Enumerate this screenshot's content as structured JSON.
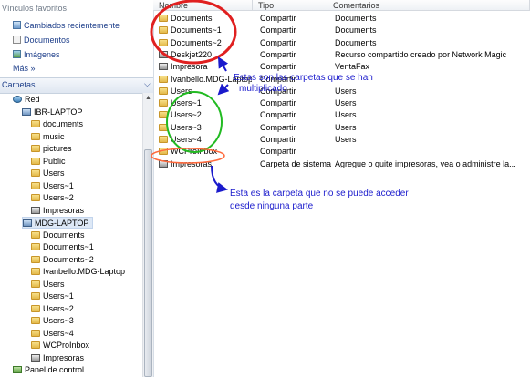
{
  "favorites": {
    "header": "Vínculos favoritos",
    "items": [
      {
        "label": "Cambiados recientemente",
        "icon": "recent-places-icon"
      },
      {
        "label": "Documentos",
        "icon": "documents-icon"
      },
      {
        "label": "Imágenes",
        "icon": "pictures-icon"
      }
    ],
    "more": "Más »"
  },
  "tree": {
    "header": "Carpetas",
    "items": [
      {
        "label": "Red",
        "icon": "network-icon"
      },
      {
        "label": "IBR-LAPTOP",
        "icon": "computer-icon"
      },
      {
        "label": "documents",
        "icon": "folder-icon"
      },
      {
        "label": "music",
        "icon": "folder-icon"
      },
      {
        "label": "pictures",
        "icon": "folder-icon"
      },
      {
        "label": "Public",
        "icon": "folder-icon"
      },
      {
        "label": "Users",
        "icon": "folder-icon"
      },
      {
        "label": "Users~1",
        "icon": "folder-icon"
      },
      {
        "label": "Users~2",
        "icon": "folder-icon"
      },
      {
        "label": "Impresoras",
        "icon": "printer-icon"
      },
      {
        "label": "MDG-LAPTOP",
        "icon": "computer-icon"
      },
      {
        "label": "Documents",
        "icon": "folder-icon"
      },
      {
        "label": "Documents~1",
        "icon": "folder-icon"
      },
      {
        "label": "Documents~2",
        "icon": "folder-icon"
      },
      {
        "label": "Ivanbello.MDG-Laptop",
        "icon": "folder-icon"
      },
      {
        "label": "Users",
        "icon": "folder-icon"
      },
      {
        "label": "Users~1",
        "icon": "folder-icon"
      },
      {
        "label": "Users~2",
        "icon": "folder-icon"
      },
      {
        "label": "Users~3",
        "icon": "folder-icon"
      },
      {
        "label": "Users~4",
        "icon": "folder-icon"
      },
      {
        "label": "WCProInbox",
        "icon": "folder-icon"
      },
      {
        "label": "Impresoras",
        "icon": "printer-icon"
      },
      {
        "label": "Panel de control",
        "icon": "control-panel-icon"
      }
    ]
  },
  "table": {
    "columns": [
      "Nombre",
      "Tipo",
      "Comentarios"
    ],
    "rows": [
      {
        "name": "Documents",
        "type": "Compartir",
        "comment": "Documents",
        "icon": "folder-icon"
      },
      {
        "name": "Documents~1",
        "type": "Compartir",
        "comment": "Documents",
        "icon": "folder-icon"
      },
      {
        "name": "Documents~2",
        "type": "Compartir",
        "comment": "Documents",
        "icon": "folder-icon"
      },
      {
        "name": "Deskjet220",
        "type": "Compartir",
        "comment": "Recurso compartido creado por Network Magic",
        "icon": "printer-icon"
      },
      {
        "name": "Impresora",
        "type": "Compartir",
        "comment": "VentaFax",
        "icon": "printer-icon"
      },
      {
        "name": "Ivanbello.MDG-Laptop",
        "type": "Compartir",
        "comment": "",
        "icon": "folder-icon"
      },
      {
        "name": "Users",
        "type": "Compartir",
        "comment": "Users",
        "icon": "folder-icon"
      },
      {
        "name": "Users~1",
        "type": "Compartir",
        "comment": "Users",
        "icon": "folder-icon"
      },
      {
        "name": "Users~2",
        "type": "Compartir",
        "comment": "Users",
        "icon": "folder-icon"
      },
      {
        "name": "Users~3",
        "type": "Compartir",
        "comment": "Users",
        "icon": "folder-icon"
      },
      {
        "name": "Users~4",
        "type": "Compartir",
        "comment": "Users",
        "icon": "folder-icon"
      },
      {
        "name": "WCProInbox",
        "type": "Compartir",
        "comment": "",
        "icon": "folder-icon"
      },
      {
        "name": "Impresoras",
        "type": "Carpeta de sistema",
        "comment": "Agregue o quite impresoras, vea o administre la...",
        "icon": "printer-icon"
      }
    ]
  },
  "annotations": {
    "multiplied_line1": "Estas son las carpetas que se han",
    "multiplied_line2": "multiplicado",
    "inaccessible_line1": "Esta es la carpeta que no se puede acceder",
    "inaccessible_line2": "desde ninguna parte",
    "circle_color_red": "#e02020",
    "circle_color_green": "#22bb22",
    "circle_color_orange": "#ff6a3d",
    "arrow_color": "#1a1acc"
  }
}
